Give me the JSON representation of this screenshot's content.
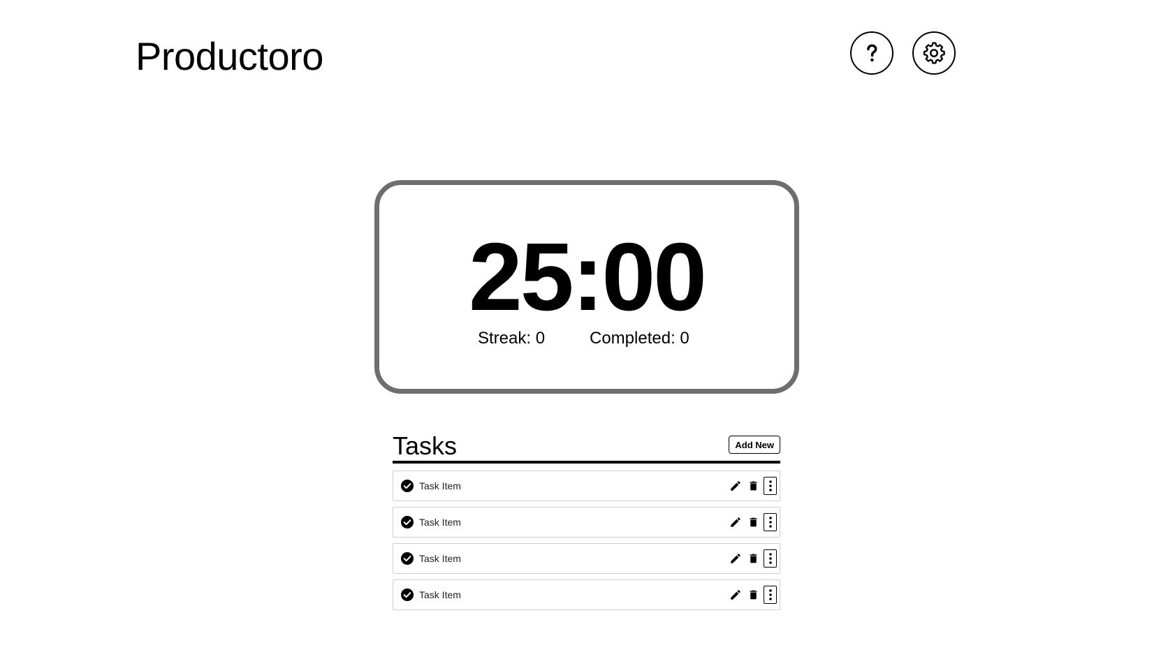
{
  "app": {
    "title": "Productoro"
  },
  "header": {
    "help_icon": "help-question-icon",
    "settings_icon": "gear-icon"
  },
  "timer": {
    "display": "25:00",
    "streak_text": "Streak: 0",
    "completed_text": "Completed: 0",
    "border_color": "#6e6e6e"
  },
  "tasks": {
    "title": "Tasks",
    "add_new_label": "Add New",
    "items": [
      {
        "label": "Task Item"
      },
      {
        "label": "Task Item"
      },
      {
        "label": "Task Item"
      },
      {
        "label": "Task Item"
      }
    ],
    "row_icons": [
      "check-circle-icon",
      "pencil-icon",
      "trash-icon",
      "more-vertical-icon"
    ]
  }
}
